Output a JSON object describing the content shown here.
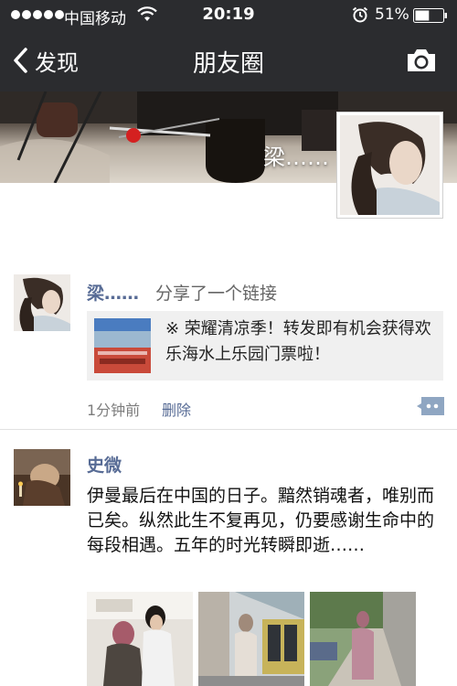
{
  "status_bar": {
    "carrier": "中国移动",
    "time": "20:19",
    "battery": "51%",
    "icons": [
      "signal-dots",
      "wifi-icon",
      "alarm-icon",
      "battery-icon"
    ],
    "battery_level": 0.51
  },
  "nav": {
    "back_label": "发现",
    "title": "朋友圈",
    "back_icon": "chevron-left-icon",
    "right_icon": "camera-icon"
  },
  "cover": {
    "name": "梁……"
  },
  "posts": [
    {
      "author": "梁……",
      "action": "分享了一个链接",
      "link_title": "※ 荣耀清凉季！转发即有机会获得欢乐海水上乐园门票啦！",
      "time": "1分钟前",
      "delete_label": "删除"
    },
    {
      "author": "史微",
      "text": "伊曼最后在中国的日子。黯然销魂者，唯别而已矣。纵然此生不复再见，仍要感谢生命中的每段相遇。五年的时光转瞬即逝……"
    }
  ],
  "colors": {
    "bar_bg": "#2b2c2f",
    "link_blue": "#576b95",
    "card_bg": "#f0f0f0",
    "time_gray": "#7d7d7d"
  }
}
